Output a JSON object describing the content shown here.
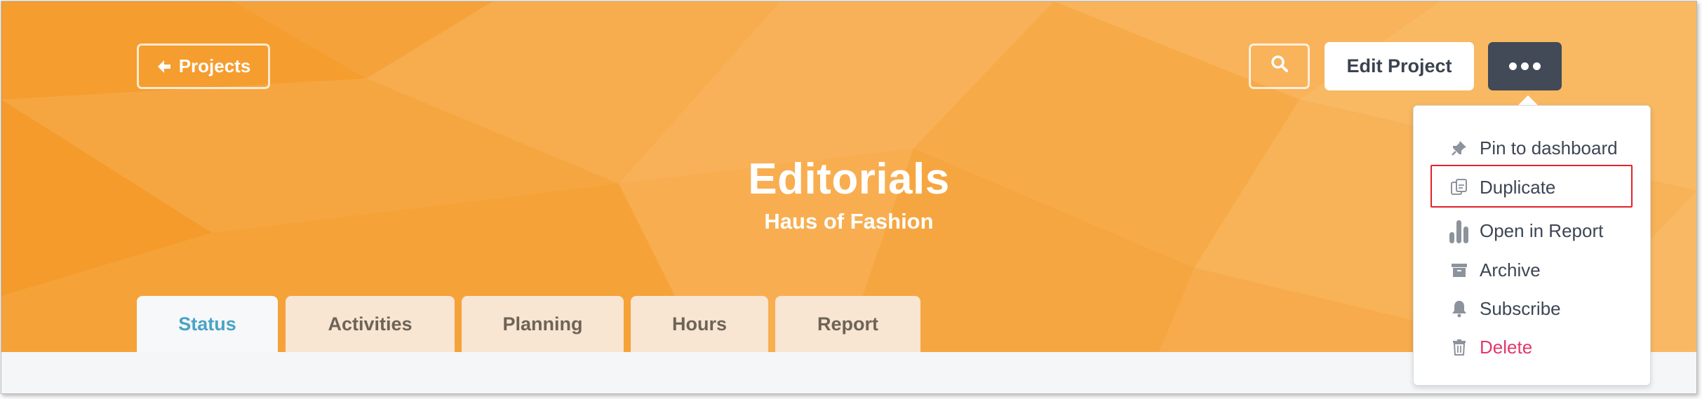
{
  "colors": {
    "hero_background": "#f6a338",
    "more_button": "#414a56",
    "active_tab_text": "#4aa3c5",
    "danger": "#e3386a",
    "highlight": "#e0232a"
  },
  "header": {
    "back_label": "Projects",
    "back_icon": "arrow-left-icon",
    "search_icon": "search-icon",
    "edit_label": "Edit Project",
    "more_icon": "ellipsis-icon"
  },
  "project": {
    "title": "Editorials",
    "subtitle": "Haus of Fashion"
  },
  "tabs": [
    {
      "label": "Status",
      "active": true
    },
    {
      "label": "Activities"
    },
    {
      "label": "Planning"
    },
    {
      "label": "Hours"
    },
    {
      "label": "Report"
    }
  ],
  "menu": {
    "items": [
      {
        "label": "Pin to dashboard",
        "icon": "pin-icon"
      },
      {
        "label": "Duplicate",
        "icon": "duplicate-icon",
        "highlighted": true
      },
      {
        "label": "Open in Report",
        "icon": "bar-chart-icon"
      },
      {
        "label": "Archive",
        "icon": "archive-icon"
      },
      {
        "label": "Subscribe",
        "icon": "bell-icon"
      },
      {
        "label": "Delete",
        "icon": "trash-icon",
        "danger": true
      }
    ]
  }
}
